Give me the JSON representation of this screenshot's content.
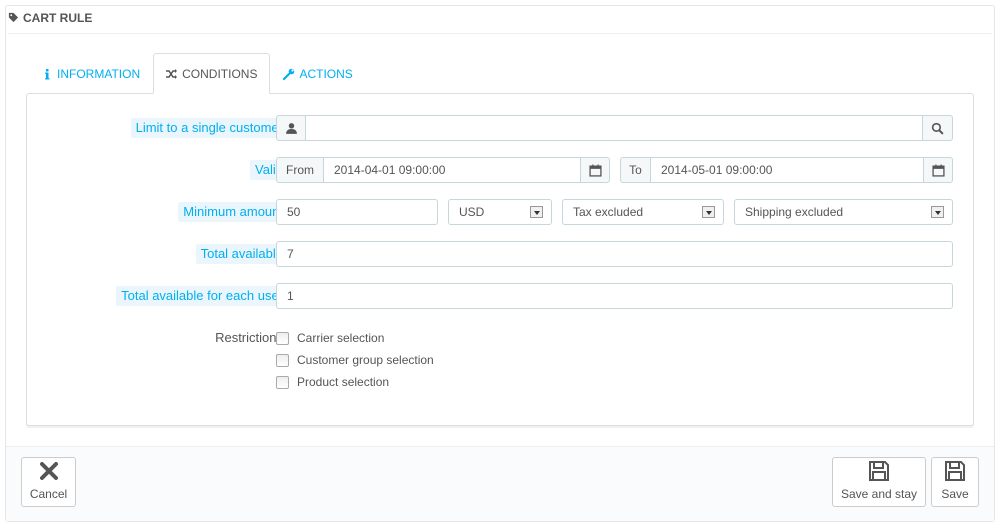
{
  "panel": {
    "title": "CART RULE",
    "title_icon": "tag-icon"
  },
  "tabs": [
    {
      "label": "INFORMATION",
      "icon": "info-icon",
      "active": false
    },
    {
      "label": "CONDITIONS",
      "icon": "shuffle-icon",
      "active": true
    },
    {
      "label": "ACTIONS",
      "icon": "wrench-icon",
      "active": false
    }
  ],
  "form": {
    "limit_customer": {
      "label": "Limit to a single customer",
      "value": ""
    },
    "valid": {
      "label": "Valid",
      "from_label": "From",
      "from_value": "2014-04-01 09:00:00",
      "to_label": "To",
      "to_value": "2014-05-01 09:00:00"
    },
    "minimum_amount": {
      "label": "Minimum amount",
      "value": "50",
      "currency": "USD",
      "tax": "Tax excluded",
      "shipping": "Shipping excluded"
    },
    "total_available": {
      "label": "Total available",
      "value": "7"
    },
    "total_per_user": {
      "label": "Total available for each user",
      "value": "1"
    },
    "restrictions": {
      "label": "Restrictions",
      "options": [
        "Carrier selection",
        "Customer group selection",
        "Product selection"
      ]
    }
  },
  "footer": {
    "cancel_label": "Cancel",
    "save_stay_label": "Save and stay",
    "save_label": "Save"
  },
  "colors": {
    "accent": "#00aff0",
    "label_bg": "#eaf6fb"
  }
}
